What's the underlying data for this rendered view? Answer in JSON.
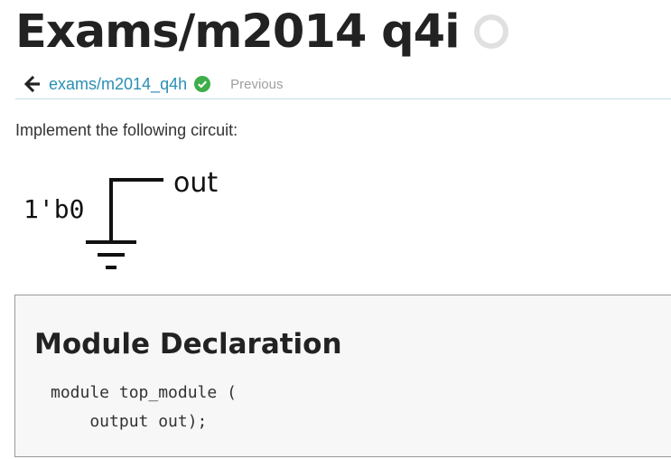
{
  "header": {
    "title": "Exams/m2014 q4i"
  },
  "nav": {
    "previous_problem_link": "exams/m2014_q4h",
    "previous_label": "Previous"
  },
  "content": {
    "intro": "Implement the following circuit:",
    "circuit": {
      "input_label": "1'b0",
      "output_label": "out"
    }
  },
  "module_declaration": {
    "heading": "Module Declaration",
    "code_lines": [
      "module top_module (",
      "    output out);"
    ]
  },
  "colors": {
    "link": "#2a8fb5",
    "check": "#3dae49",
    "status_ring": "#e0e0e0",
    "divider": "#bfe0e6"
  }
}
